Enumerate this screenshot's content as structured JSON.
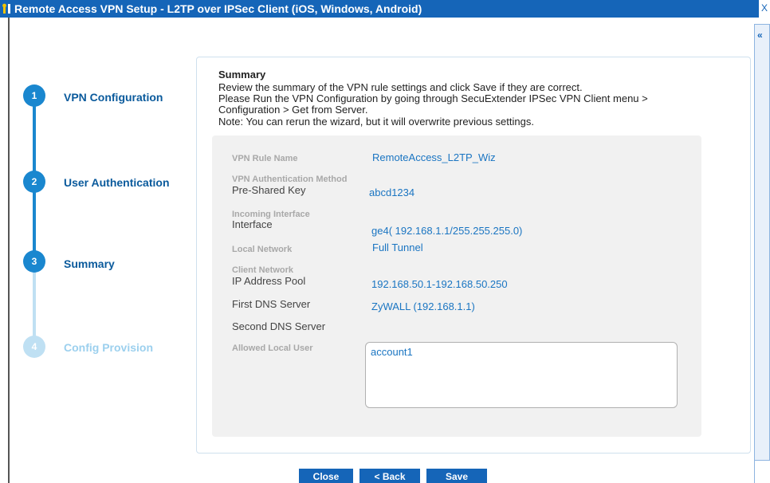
{
  "window": {
    "title": "Remote Access VPN Setup - L2TP over IPSec Client (iOS, Windows, Android)",
    "close_glyph": "X",
    "collapse_glyph": "«"
  },
  "steps": [
    {
      "number": "1",
      "label": "VPN Configuration",
      "state": "done"
    },
    {
      "number": "2",
      "label": "User Authentication",
      "state": "done"
    },
    {
      "number": "3",
      "label": "Summary",
      "state": "current"
    },
    {
      "number": "4",
      "label": "Config Provision",
      "state": "pending"
    }
  ],
  "summary": {
    "title": "Summary",
    "description_lines": [
      "Review the summary of the VPN rule settings and click Save if they are correct.",
      "Please Run the VPN Configuration by going through SecuExtender IPSec VPN Client menu >",
      "Configuration > Get from Server.",
      "Note: You can rerun the wizard, but it will overwrite previous settings."
    ],
    "fields": {
      "rule_name": {
        "label": "VPN Rule Name",
        "value": "RemoteAccess_L2TP_Wiz"
      },
      "auth_method": {
        "section": "VPN Authentication Method",
        "label": "Pre-Shared Key",
        "value": "abcd1234"
      },
      "incoming_interface": {
        "section": "Incoming Interface",
        "label": "Interface",
        "value": "ge4( 192.168.1.1/255.255.255.0)"
      },
      "local_network": {
        "label": "Local Network",
        "value": "Full Tunnel"
      },
      "client_network": {
        "section": "Client Network",
        "label": "IP Address Pool",
        "value": "192.168.50.1-192.168.50.250"
      },
      "first_dns": {
        "label": "First DNS Server",
        "value": "ZyWALL (192.168.1.1)"
      },
      "second_dns": {
        "label": "Second DNS Server",
        "value": ""
      },
      "allowed_user": {
        "label": "Allowed Local User",
        "value": "account1"
      }
    }
  },
  "buttons": {
    "close": "Close",
    "back": "< Back",
    "save": "Save"
  },
  "colors": {
    "titlebar": "#1565b8",
    "step_active": "#1a87cf",
    "step_inactive": "#bfe0f3",
    "value_text": "#1a75c2",
    "summary_bg": "#f1f1f1"
  }
}
